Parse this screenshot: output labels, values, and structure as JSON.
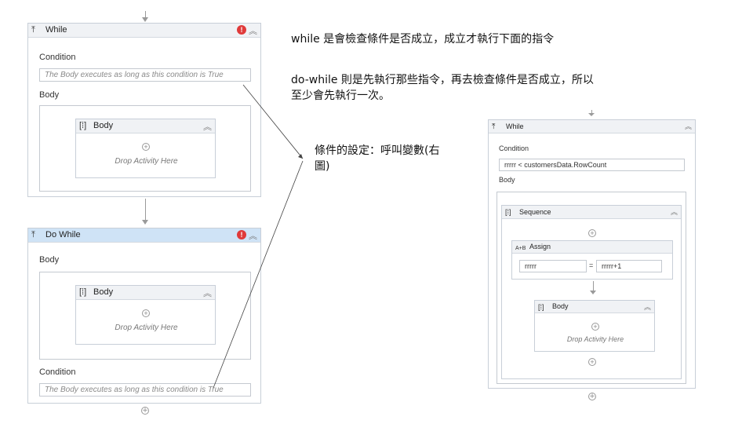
{
  "left_designer": {
    "while": {
      "title": "While",
      "error_icon": "!",
      "condition_label": "Condition",
      "condition_placeholder": "The Body executes as long as this condition is True",
      "body_label": "Body",
      "inner_body_title": "Body",
      "drop_text": "Drop Activity Here"
    },
    "do_while": {
      "title": "Do While",
      "error_icon": "!",
      "body_label": "Body",
      "inner_body_title": "Body",
      "drop_text": "Drop Activity Here",
      "condition_label": "Condition",
      "condition_placeholder": "The Body executes as long as this condition is True"
    }
  },
  "notes": {
    "while_line": "while 是會檢查條件是否成立，成立才執行下面的指令",
    "dowhile_line1": "do-while 則是先執行那些指令，再去檢查條件是否成立，所以",
    "dowhile_line2": "至少會先執行一次。",
    "condition_note_line1": "條件的設定：呼叫變數(右",
    "condition_note_line2": "圖)"
  },
  "right_designer": {
    "while_title": "While",
    "condition_label": "Condition",
    "condition_value": "rrrrr < customersData.RowCount",
    "body_label": "Body",
    "sequence_title": "Sequence",
    "assign_title": "Assign",
    "assign_to": "rrrrr",
    "assign_eq": "=",
    "assign_value": "rrrrr+1",
    "inner_body_title": "Body",
    "drop_text": "Drop Activity Here"
  },
  "colors": {
    "accent_selected": "#cfe3f6",
    "error": "#e03a3a",
    "border": "#c8cfd8"
  }
}
